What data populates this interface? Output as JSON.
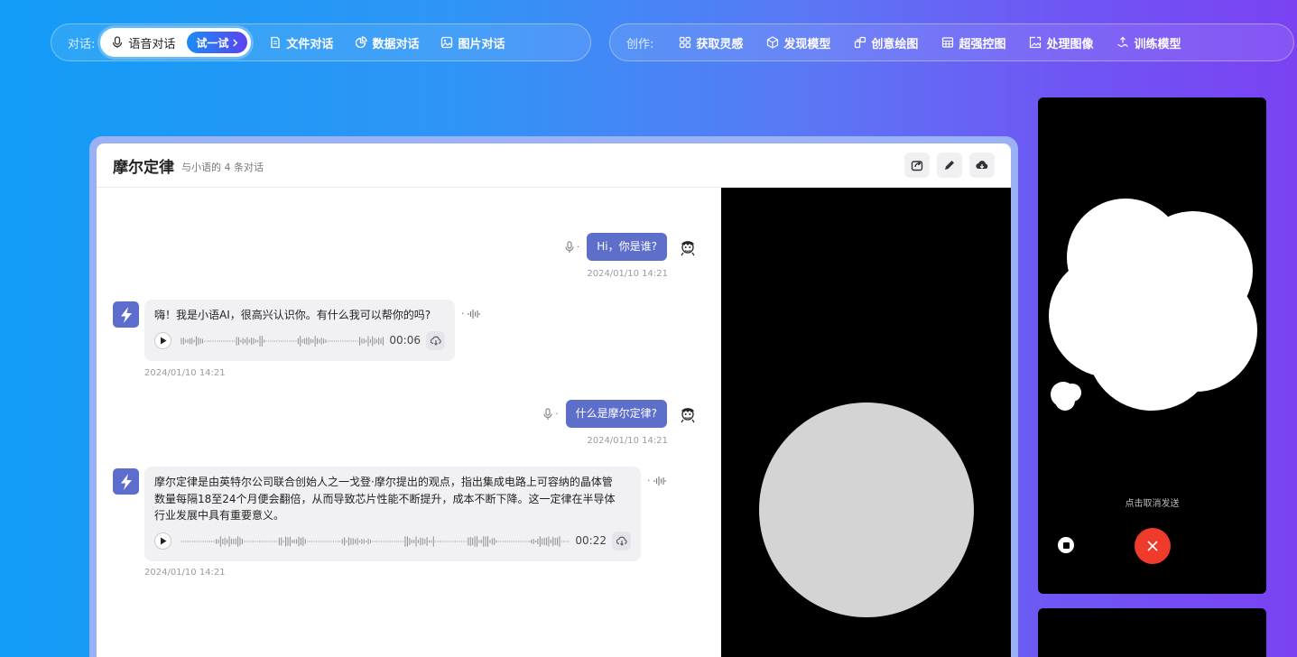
{
  "nav": {
    "dialog": {
      "prefix": "对话:",
      "items": [
        {
          "label": "语音对话",
          "icon": "mic-icon",
          "active": true
        },
        {
          "label": "文件对话",
          "icon": "file-icon"
        },
        {
          "label": "数据对话",
          "icon": "chart-pie-icon"
        },
        {
          "label": "图片对话",
          "icon": "image-icon"
        }
      ],
      "try_label": "试一试"
    },
    "create": {
      "prefix": "创作:",
      "items": [
        {
          "label": "获取灵感",
          "icon": "grid-icon"
        },
        {
          "label": "发现模型",
          "icon": "cube-icon"
        },
        {
          "label": "创意绘图",
          "icon": "palette-icon"
        },
        {
          "label": "超强控图",
          "icon": "layout-icon"
        },
        {
          "label": "处理图像",
          "icon": "image-edit-icon"
        },
        {
          "label": "训练模型",
          "icon": "train-icon"
        }
      ]
    }
  },
  "chat": {
    "title": "摩尔定律",
    "subtitle": "与小语的 4 条对话",
    "actions": [
      "share-icon",
      "edit-icon",
      "cloud-download-icon"
    ],
    "messages": [
      {
        "role": "user",
        "text": "Hi，你是谁?",
        "time": "2024/01/10 14:21"
      },
      {
        "role": "ai",
        "text": "嗨！我是小语AI，很高兴认识你。有什么我可以帮你的吗?",
        "duration": "00:06",
        "time": "2024/01/10 14:21"
      },
      {
        "role": "user",
        "text": "什么是摩尔定律?",
        "time": "2024/01/10 14:21"
      },
      {
        "role": "ai",
        "lines": [
          "摩尔定律是由英特尔公司联合创始人之一戈登·摩尔提出的观点，指出集成电路上可容纳的晶体管",
          "数量每隔18至24个月便会翻倍，从而导致芯片性能不断提升，成本不断下降。这一定律在半导体",
          "行业发展中具有重要意义。"
        ],
        "duration": "00:22",
        "time": "2024/01/10 14:21"
      }
    ]
  },
  "recorder": {
    "hint": "点击取消发送"
  },
  "colors": {
    "accent": "#5e6fcb",
    "cancel": "#ef3b2c",
    "card_frame": "#9ab1f6"
  }
}
